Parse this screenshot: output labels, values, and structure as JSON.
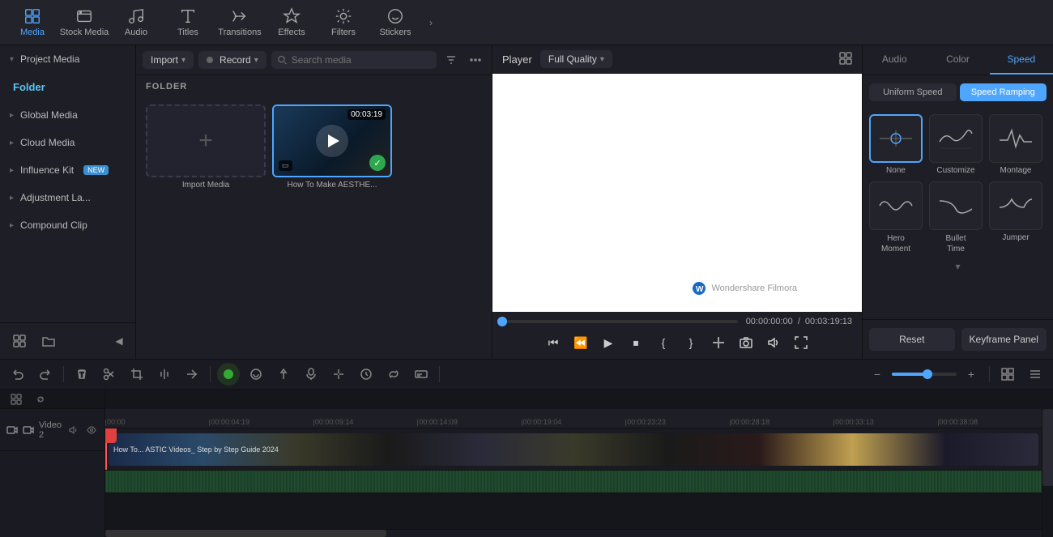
{
  "toolbar": {
    "items": [
      {
        "id": "media",
        "label": "Media",
        "active": true
      },
      {
        "id": "stock-media",
        "label": "Stock Media",
        "active": false
      },
      {
        "id": "audio",
        "label": "Audio",
        "active": false
      },
      {
        "id": "titles",
        "label": "Titles",
        "active": false
      },
      {
        "id": "transitions",
        "label": "Transitions",
        "active": false
      },
      {
        "id": "effects",
        "label": "Effects",
        "active": false
      },
      {
        "id": "filters",
        "label": "Filters",
        "active": false
      },
      {
        "id": "stickers",
        "label": "Stickers",
        "active": false
      }
    ]
  },
  "left_panel": {
    "items": [
      {
        "id": "project-media",
        "label": "Project Media",
        "active": true
      },
      {
        "id": "folder",
        "label": "Folder",
        "active": false,
        "is_folder": true
      },
      {
        "id": "global-media",
        "label": "Global Media",
        "active": false
      },
      {
        "id": "cloud-media",
        "label": "Cloud Media",
        "active": false
      },
      {
        "id": "influence-kit",
        "label": "Influence Kit",
        "active": false,
        "badge": "NEW"
      },
      {
        "id": "adjustment-layer",
        "label": "Adjustment La...",
        "active": false
      },
      {
        "id": "compound-clip",
        "label": "Compound Clip",
        "active": false
      }
    ],
    "add_label": "+",
    "folder_label": "+"
  },
  "media_panel": {
    "import_btn": "Import",
    "record_btn": "Record",
    "search_placeholder": "Search media",
    "folder_section": "FOLDER",
    "import_media_label": "Import Media",
    "video_thumb_duration": "00:03:19",
    "video_thumb_name": "How To Make AESTHE...",
    "filter_icon": "⚙",
    "more_icon": "⋯"
  },
  "player": {
    "label": "Player",
    "quality": "Full Quality",
    "current_time": "00:00:00:00",
    "total_time": "00:03:19:13",
    "separator": "/"
  },
  "right_panel": {
    "tabs": [
      {
        "id": "audio",
        "label": "Audio"
      },
      {
        "id": "color",
        "label": "Color"
      },
      {
        "id": "speed",
        "label": "Speed",
        "active": true
      }
    ],
    "speed_type_buttons": [
      {
        "id": "uniform-speed",
        "label": "Uniform Speed"
      },
      {
        "id": "speed-ramping",
        "label": "Speed Ramping",
        "active": true
      }
    ],
    "speed_cards": [
      {
        "id": "none",
        "label": "None",
        "selected": true
      },
      {
        "id": "customize",
        "label": "Customize"
      },
      {
        "id": "montage",
        "label": "Montage"
      },
      {
        "id": "hero-moment",
        "label": "Hero\nMoment"
      },
      {
        "id": "bullet-time",
        "label": "Bullet\nTime"
      },
      {
        "id": "jumper",
        "label": "Jumper"
      }
    ],
    "reset_btn": "Reset",
    "keyframe_btn": "Keyframe Panel"
  },
  "timeline": {
    "ruler_marks": [
      "00:00",
      "00:00:04:19",
      "00:00:09:14",
      "00:00:14:09",
      "00:00:19:04",
      "00:00:23:23",
      "00:00:28:18",
      "00:00:33:13",
      "00:00:38:08"
    ],
    "track_label": "Video 2",
    "clip_label": "How To... ASTIC Videos_ Step by Step Guide 2024"
  }
}
